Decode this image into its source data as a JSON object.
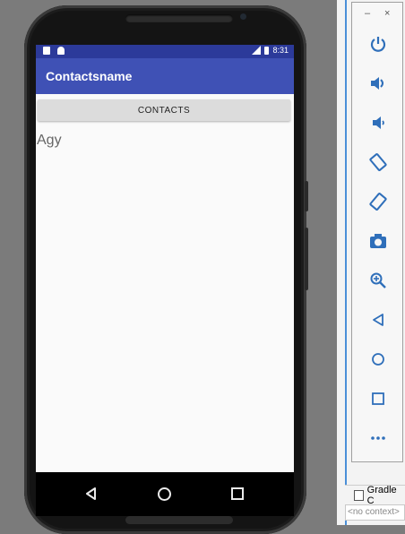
{
  "status_bar": {
    "time": "8:31"
  },
  "app": {
    "title": "Contactsname",
    "contacts_button": "CONTACTS",
    "contact_text": "Agy"
  },
  "emulator_toolbar": {
    "minimize": "–",
    "close": "×",
    "buttons": [
      "power-icon",
      "volume-up-icon",
      "volume-down-icon",
      "rotate-left-icon",
      "rotate-right-icon",
      "camera-icon",
      "zoom-icon",
      "back-icon",
      "home-icon",
      "overview-icon",
      "more-icon"
    ]
  },
  "ide": {
    "gradle_tab": "Gradle C",
    "context": "<no context>"
  },
  "colors": {
    "status_bar": "#2c3a9a",
    "app_bar": "#3f51b5",
    "content_bg": "#fafafa",
    "button_bg": "#dcdcdc"
  }
}
